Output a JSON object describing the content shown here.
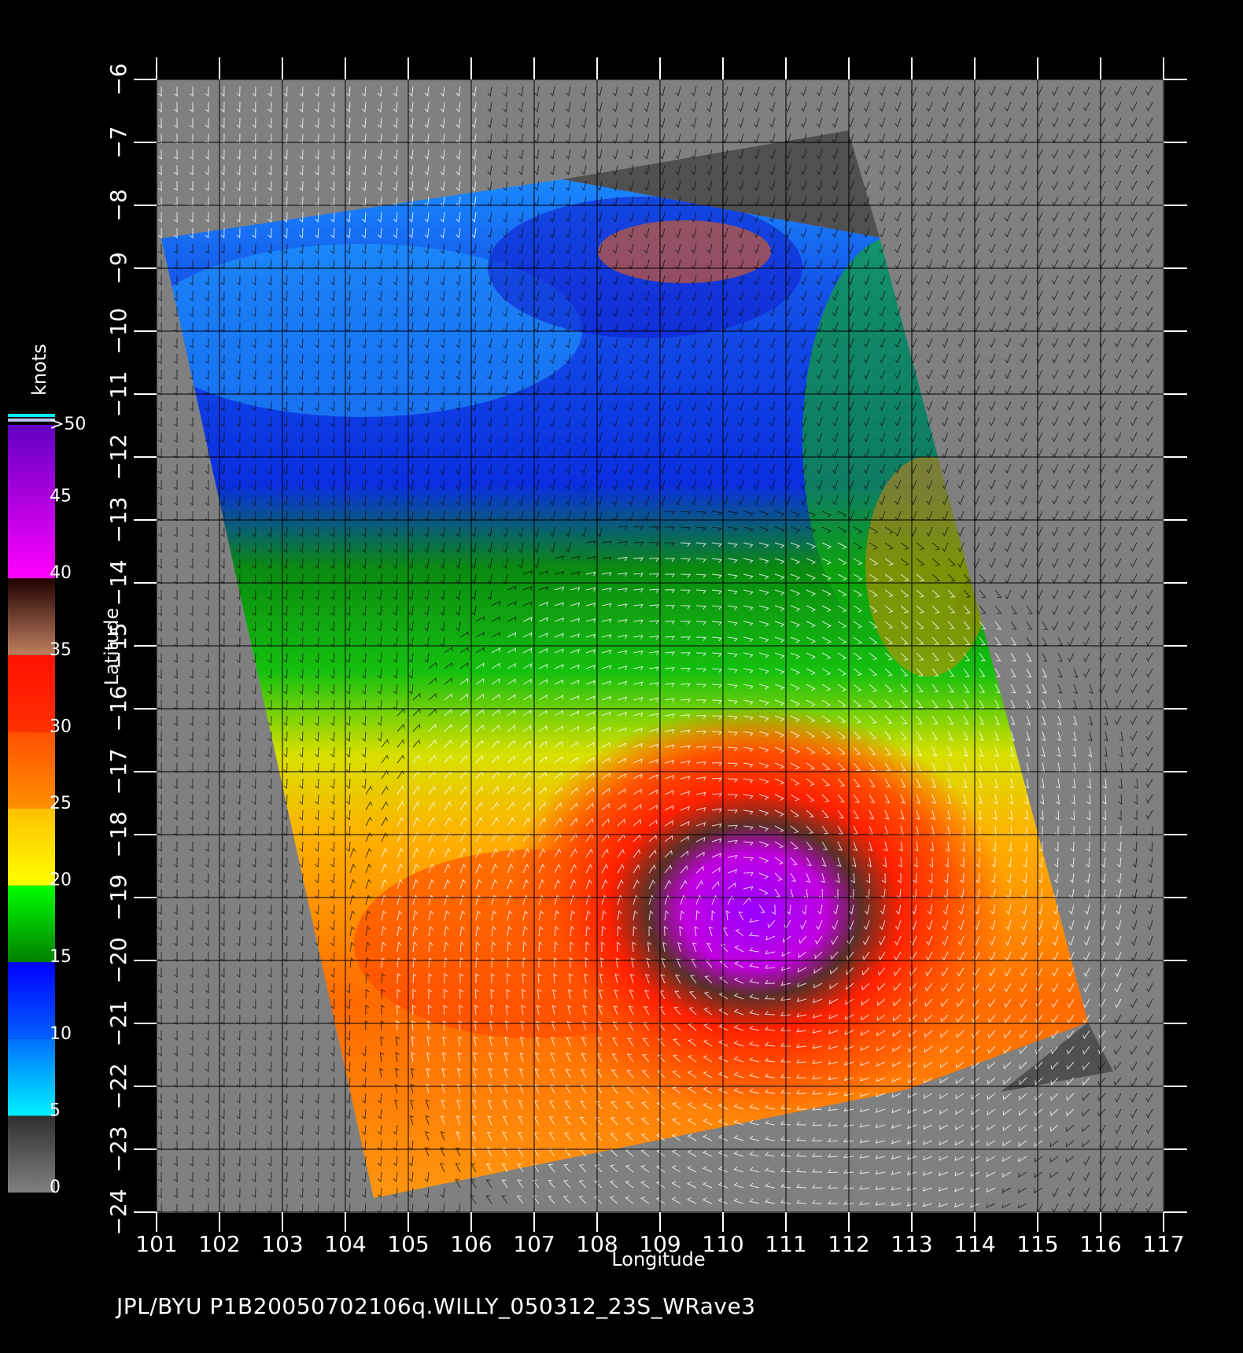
{
  "map": {
    "xlabel": "Longitude",
    "ylabel": "Latitude",
    "lon_ticks": [
      "101",
      "102",
      "103",
      "104",
      "105",
      "106",
      "107",
      "108",
      "109",
      "110",
      "111",
      "112",
      "113",
      "114",
      "115",
      "116",
      "117"
    ],
    "lat_ticks": [
      "−6",
      "−7",
      "−8",
      "−9",
      "−10",
      "−11",
      "−12",
      "−13",
      "−14",
      "−15",
      "−16",
      "−17",
      "−18",
      "−19",
      "−20",
      "−21",
      "−22",
      "−23",
      "−24"
    ],
    "lon_range": [
      101,
      117
    ],
    "lat_range": [
      -6,
      -24
    ],
    "storm_center": {
      "lon": 110.5,
      "lat": -19.2
    },
    "background_color": "#808080"
  },
  "colorbar": {
    "unit": "knots",
    "tick_labels": [
      ">50",
      "45",
      "40",
      "35",
      "30",
      "25",
      "20",
      "15",
      "10",
      "5",
      "0"
    ],
    "bands": [
      {
        "from": 0,
        "to": 5,
        "colors": [
          "#808080",
          "#303030"
        ]
      },
      {
        "from": 5,
        "to": 10,
        "colors": [
          "#00f0ff",
          "#0070ff"
        ]
      },
      {
        "from": 10,
        "to": 15,
        "colors": [
          "#0060ff",
          "#0000ff"
        ]
      },
      {
        "from": 15,
        "to": 20,
        "colors": [
          "#008000",
          "#00ff00"
        ]
      },
      {
        "from": 20,
        "to": 25,
        "colors": [
          "#ffff00",
          "#ffc000"
        ]
      },
      {
        "from": 25,
        "to": 30,
        "colors": [
          "#ff9000",
          "#ff5000"
        ]
      },
      {
        "from": 30,
        "to": 35,
        "colors": [
          "#ff3000",
          "#ff1000"
        ]
      },
      {
        "from": 35,
        "to": 40,
        "colors": [
          "#c08060",
          "#200000"
        ]
      },
      {
        "from": 40,
        "to": 50,
        "colors": [
          "#ff00ff",
          "#6000c0"
        ]
      }
    ]
  },
  "caption": "JPL/BYU   P1B20050702106q.WILLY_050312_23S_WRave3"
}
